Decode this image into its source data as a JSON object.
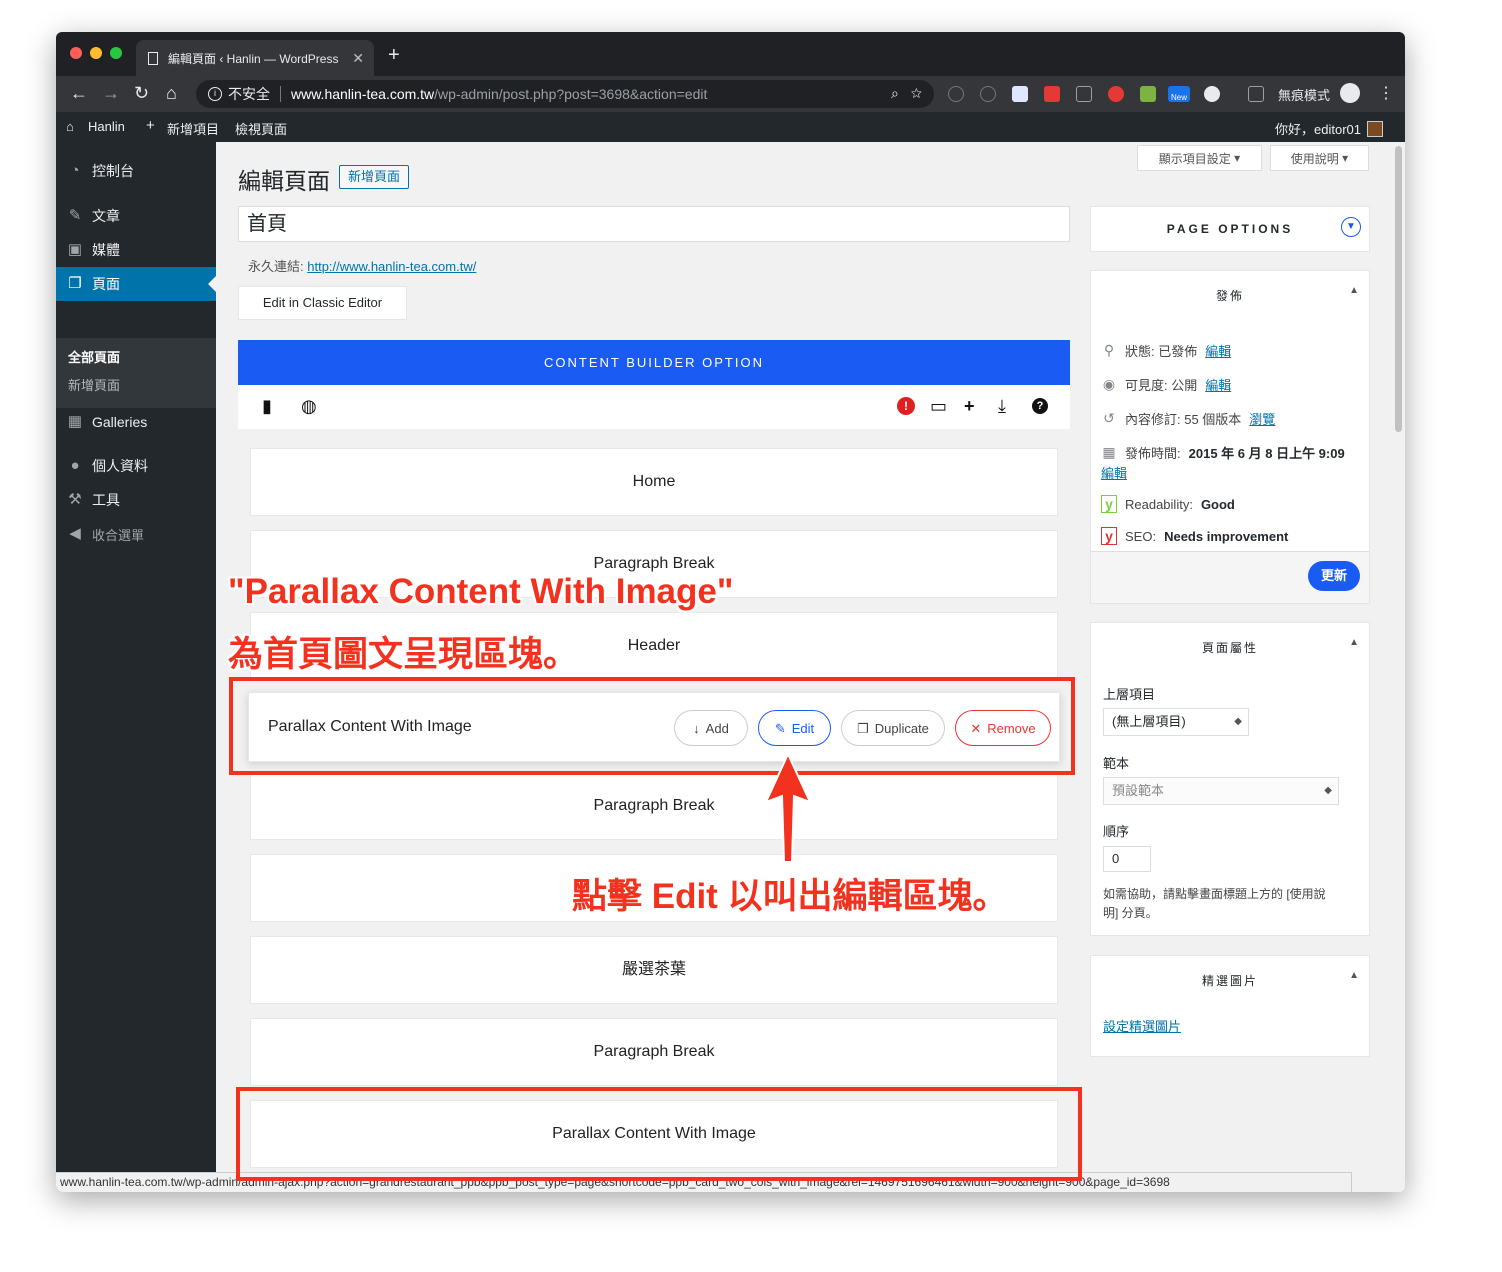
{
  "browser": {
    "tab_title": "編輯頁面 ‹ Hanlin — WordPress",
    "security_label": "不安全",
    "url_host": "www.hanlin-tea.com.tw",
    "url_path": "/wp-admin/post.php?post=3698&action=edit",
    "incognito_label": "無痕模式",
    "new_badge": "New"
  },
  "adminbar": {
    "site": "Hanlin",
    "new": "新增項目",
    "view": "檢視頁面",
    "greeting": "你好，editor01"
  },
  "sidebar": {
    "items": [
      {
        "label": "控制台",
        "icon": "dashboard-icon"
      },
      {
        "label": "文章",
        "icon": "pin-icon"
      },
      {
        "label": "媒體",
        "icon": "media-icon"
      },
      {
        "label": "頁面",
        "icon": "pages-icon"
      },
      {
        "label": "Galleries",
        "icon": "gallery-icon"
      },
      {
        "label": "個人資料",
        "icon": "user-icon"
      },
      {
        "label": "工具",
        "icon": "wrench-icon"
      },
      {
        "label": "收合選單",
        "icon": "collapse-icon"
      }
    ],
    "submenu": [
      "全部頁面",
      "新增頁面"
    ]
  },
  "header": {
    "screen_options": "顯示項目設定",
    "help": "使用說明",
    "title": "編輯頁面",
    "add_new": "新增頁面"
  },
  "editor": {
    "post_title": "首頁",
    "permalink_label": "永久連結:",
    "permalink_url": "http://www.hanlin-tea.com.tw/",
    "classic_button": "Edit in Classic Editor"
  },
  "builder": {
    "heading": "CONTENT BUILDER OPTION",
    "blocks": [
      "Home",
      "Paragraph Break",
      "Header",
      "Parallax Content With Image",
      "Paragraph Break",
      "",
      "嚴選茶葉",
      "Paragraph Break",
      "Parallax Content With Image"
    ],
    "actions": {
      "add": "Add",
      "edit": "Edit",
      "duplicate": "Duplicate",
      "remove": "Remove"
    }
  },
  "page_options": {
    "title": "PAGE OPTIONS"
  },
  "publish": {
    "title": "發佈",
    "status_label": "狀態: 已發佈",
    "visibility_label": "可見度: 公開",
    "revisions_label": "內容修訂: 55 個版本",
    "browse_link": "瀏覽",
    "date_label": "發佈時間:",
    "date_value": "2015 年 6 月 8 日上午 9:09",
    "edit_link": "編輯",
    "readability_label": "Readability:",
    "readability_value": "Good",
    "seo_label": "SEO:",
    "seo_value": "Needs improvement",
    "update_button": "更新"
  },
  "attributes": {
    "title": "頁面屬性",
    "parent_label": "上層項目",
    "parent_value": "(無上層項目)",
    "template_label": "範本",
    "template_value": "預設範本",
    "order_label": "順序",
    "order_value": "0",
    "help_text_1": "如需協助，請點擊畫面標題上方的 [使用說",
    "help_text_2": "明] 分頁。"
  },
  "featured": {
    "title": "精選圖片",
    "set_link": "設定精選圖片"
  },
  "statusbar": "www.hanlin-tea.com.tw/wp-admin/admin-ajax.php?action=grandrestaurant_ppb&ppb_post_type=page&shortcode=ppb_card_two_cols_with_image&rel=1469751696461&width=900&height=900&page_id=3698",
  "annotations": {
    "line1": "\"Parallax Content With Image\"",
    "line2": "為首頁圖文呈現區塊。",
    "line3": "點擊 Edit 以叫出編輯區塊。"
  },
  "colors": {
    "accent": "#1a5cf3",
    "annotation": "#f2321f",
    "wp_sidebar": "#23282d",
    "wp_active": "#0073aa"
  }
}
